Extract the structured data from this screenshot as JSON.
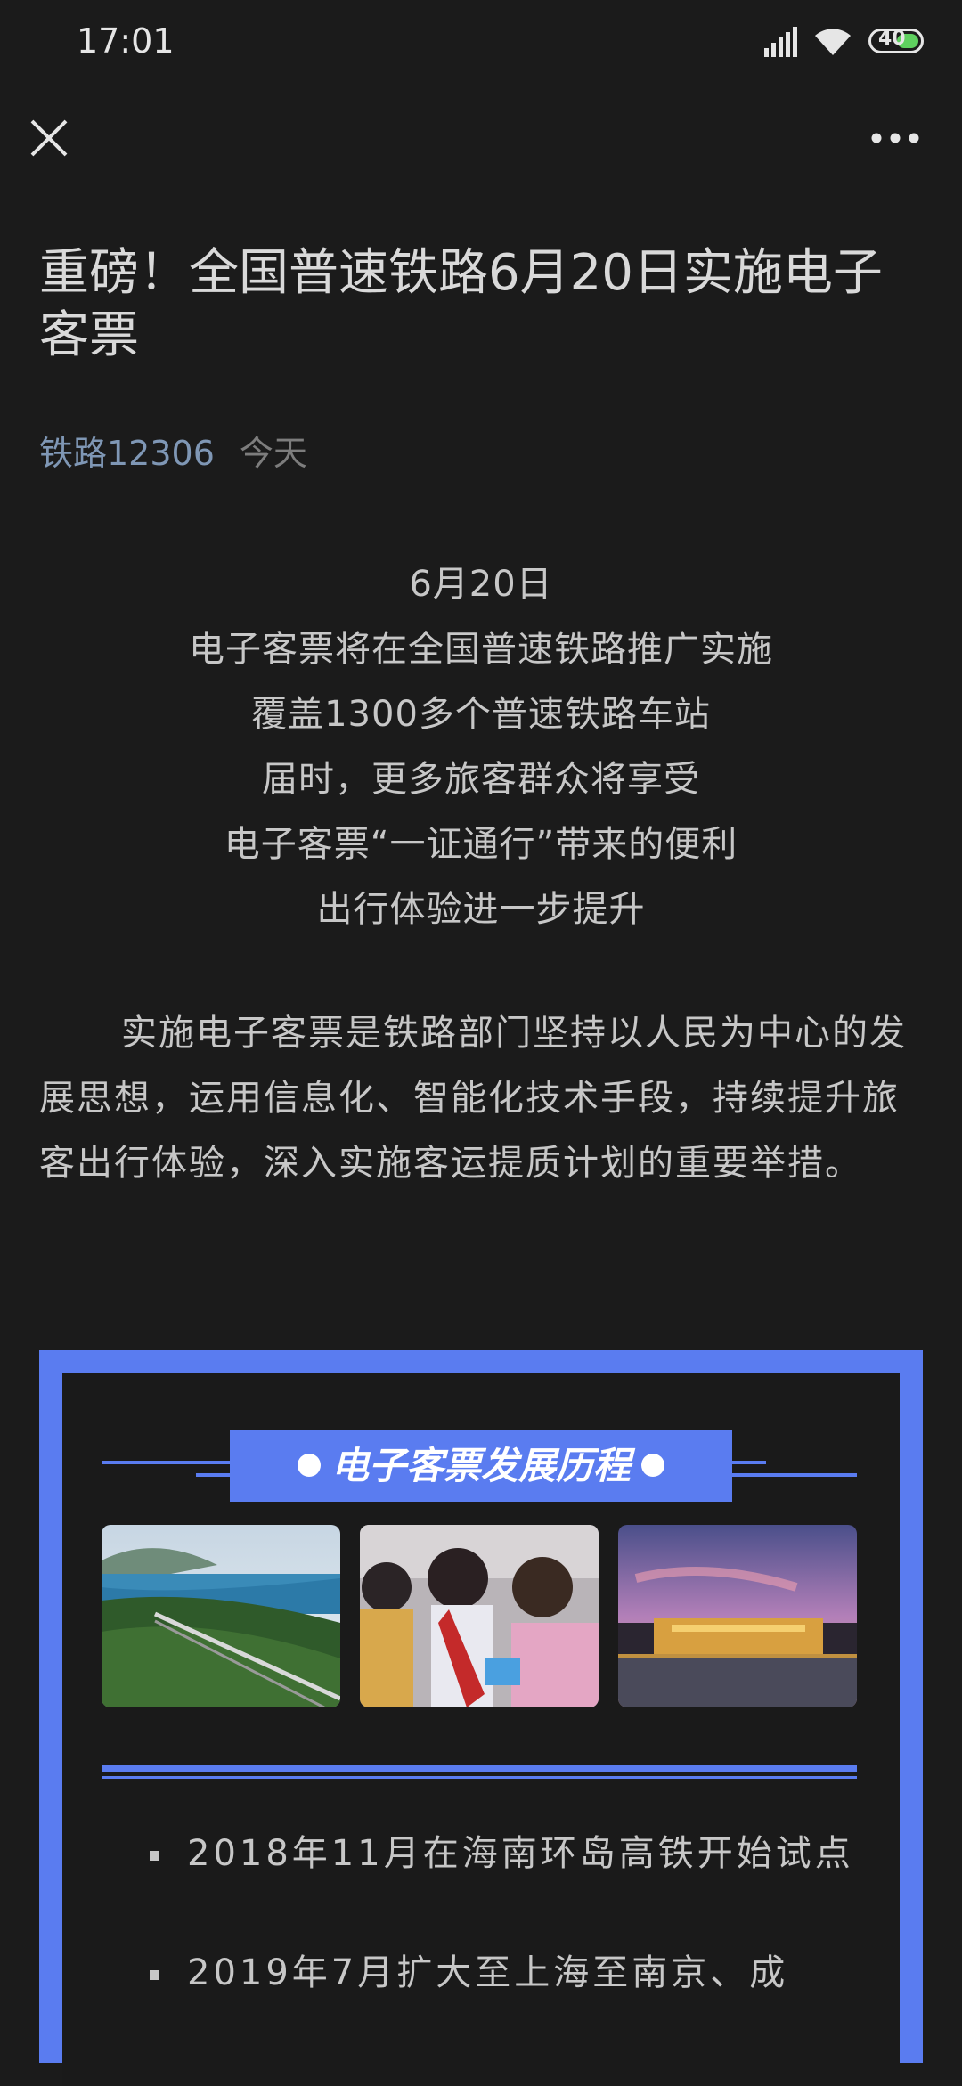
{
  "status_bar": {
    "time": "17:01",
    "battery": "40"
  },
  "colors": {
    "accent": "#5a7cf0",
    "background": "#1b1b1b",
    "author": "#7f97b5"
  },
  "icons": {
    "close": "close-icon",
    "more": "more-icon"
  },
  "article": {
    "title": "重磅！全国普速铁路6月20日实施电子客票",
    "author": "铁路12306",
    "date": "今天",
    "center_lines": [
      "6月20日",
      "电子客票将在全国普速铁路推广实施",
      "覆盖1300多个普速铁路车站",
      "届时，更多旅客群众将享受",
      "电子客票“一证通行”带来的便利",
      "出行体验进一步提升"
    ],
    "paragraph": "实施电子客票是铁路部门坚持以人民为中心的发展思想，运用信息化、智能化技术手段，持续提升旅客出行体验，深入实施客运提质计划的重要举措。"
  },
  "timeline": {
    "heading": "电子客票发展历程",
    "bullets": [
      "2018年11月在海南环岛高铁开始试点",
      "2019年7月扩大至上海至南京、成"
    ]
  }
}
